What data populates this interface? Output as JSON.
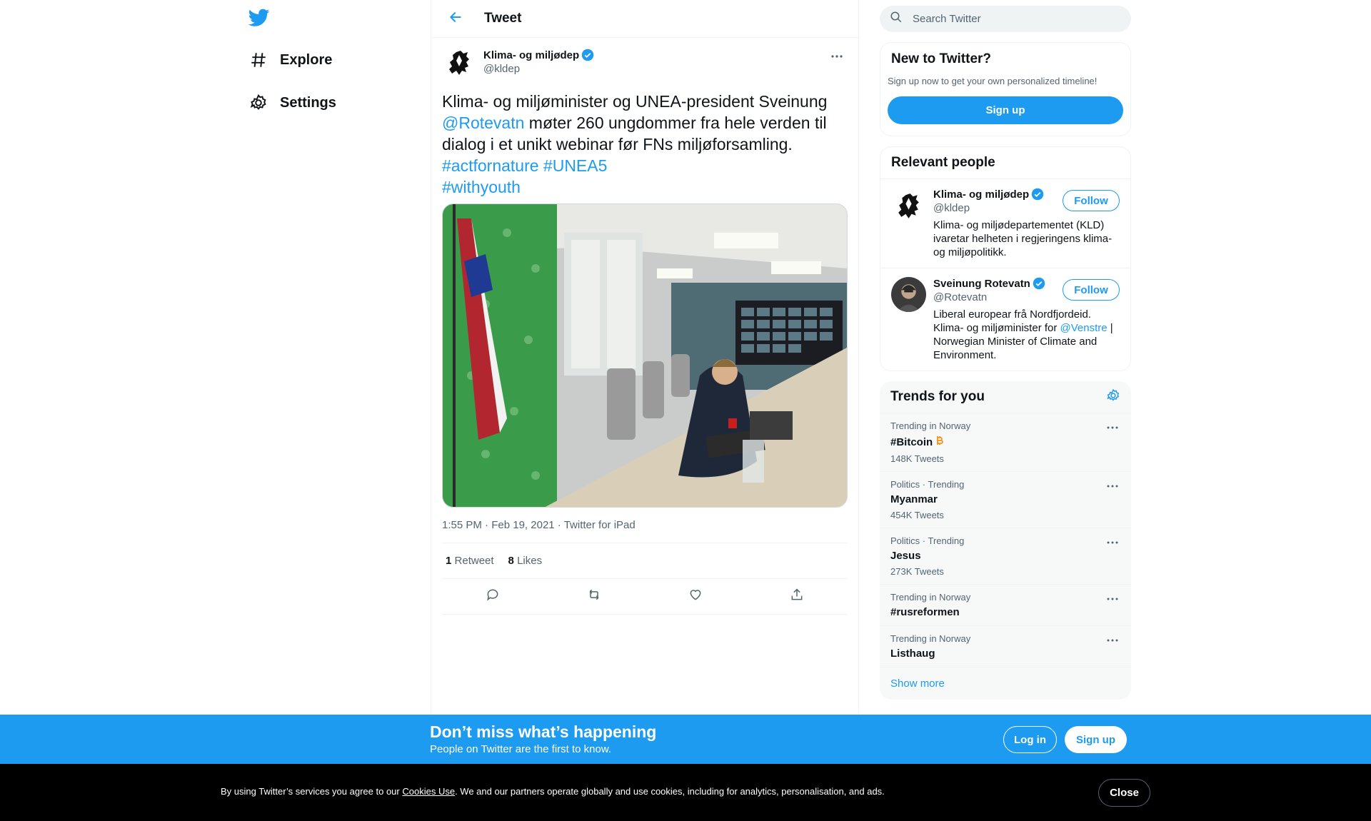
{
  "colors": {
    "accent": "#1d9bf0",
    "text": "#0f1419",
    "muted": "#536471",
    "bitcoin": "#f7931a"
  },
  "nav": {
    "logo_icon": "twitter-bird-icon",
    "items": [
      {
        "label": "Explore",
        "icon": "hashtag-icon"
      },
      {
        "label": "Settings",
        "icon": "gear-icon"
      }
    ]
  },
  "header": {
    "title": "Tweet",
    "back_icon": "arrow-left-icon"
  },
  "tweet": {
    "author_name": "Klima- og miljødep",
    "author_handle": "@kldep",
    "text_line1": "Klima- og miljøminister og UNEA-president Sveinung",
    "mention": "@Rotevatn",
    "text_line2_rest": " møter 260 ungdommer fra hele verden til",
    "text_line3": "dialog i et unikt webinar før FNs miljøforsamling.",
    "hashtag1": "#actfornature",
    "hashtag2": "#UNEA5",
    "hashtag3": "#withyouth",
    "time": "1:55 PM",
    "date": "Feb 19, 2021",
    "source": "Twitter for iPad",
    "sep": " · ",
    "retweets": "1",
    "retweets_label": "Retweet",
    "likes": "8",
    "likes_label": "Likes"
  },
  "search": {
    "placeholder": "Search Twitter"
  },
  "new_to_twitter": {
    "title": "New to Twitter?",
    "subtitle": "Sign up now to get your own personalized timeline!",
    "button": "Sign up"
  },
  "relevant": {
    "title": "Relevant people",
    "people": [
      {
        "name": "Klima- og miljødep",
        "handle": "@kldep",
        "bio": "Klima- og miljødepartementet (KLD) ivaretar helheten i regjeringens klima- og miljøpolitikk.",
        "follow": "Follow"
      },
      {
        "name": "Sveinung Rotevatn",
        "handle": "@Rotevatn",
        "bio_before": "Liberal europear frå Nordfjordeid. Klima- og miljøminister for ",
        "bio_link": "@Venstre",
        "bio_after": " | Norwegian Minister of Climate and Environment.",
        "follow": "Follow"
      }
    ]
  },
  "trends": {
    "title": "Trends for you",
    "items": [
      {
        "context": "Trending in Norway",
        "name": "#Bitcoin",
        "count": "148K Tweets"
      },
      {
        "context": "Politics · Trending",
        "name": "Myanmar",
        "count": "454K Tweets"
      },
      {
        "context": "Politics · Trending",
        "name": "Jesus",
        "count": "273K Tweets"
      },
      {
        "context": "Trending in Norway",
        "name": "#rusreformen",
        "count": ""
      },
      {
        "context": "Trending in Norway",
        "name": "Listhaug",
        "count": ""
      }
    ],
    "show_more": "Show more"
  },
  "bottom_bar": {
    "title": "Don’t miss what’s happening",
    "subtitle": "People on Twitter are the first to know.",
    "login": "Log in",
    "signup": "Sign up"
  },
  "cookie": {
    "before": "By using Twitter’s services you agree to our ",
    "link": "Cookies Use",
    "after": ". We and our partners operate globally and use cookies, including for analytics, personalisation, and ads.",
    "close": "Close"
  }
}
